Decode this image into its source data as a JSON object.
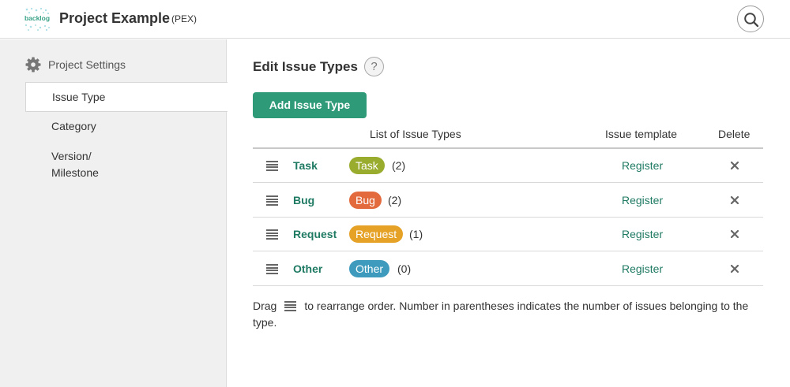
{
  "header": {
    "logo_text": "backlog",
    "project_name": "Project Example",
    "project_key": "(PEX)"
  },
  "sidebar": {
    "heading": "Project Settings",
    "items": [
      {
        "label": "Issue Type",
        "active": true
      },
      {
        "label": "Category",
        "active": false
      },
      {
        "label_line1": "Version/",
        "label_line2": "Milestone",
        "active": false
      }
    ]
  },
  "main": {
    "title": "Edit Issue Types",
    "help_label": "?",
    "add_button": "Add Issue Type",
    "columns": {
      "list": "List of Issue Types",
      "template": "Issue template",
      "delete": "Delete"
    },
    "rows": [
      {
        "name": "Task",
        "badge": "Task",
        "badge_color": "#9aac2e",
        "count": "(2)",
        "template": "Register"
      },
      {
        "name": "Bug",
        "badge": "Bug",
        "badge_color": "#e36a3c",
        "count": "(2)",
        "template": "Register"
      },
      {
        "name": "Request",
        "badge": "Request",
        "badge_color": "#e5a227",
        "count": "(1)",
        "template": "Register"
      },
      {
        "name": "Other",
        "badge": "Other",
        "badge_color": "#3e9bbd",
        "count": "(0)",
        "template": "Register"
      }
    ],
    "note_prefix": "Drag",
    "note_suffix": "to rearrange order. Number in parentheses indicates the number of issues belonging to the type."
  }
}
